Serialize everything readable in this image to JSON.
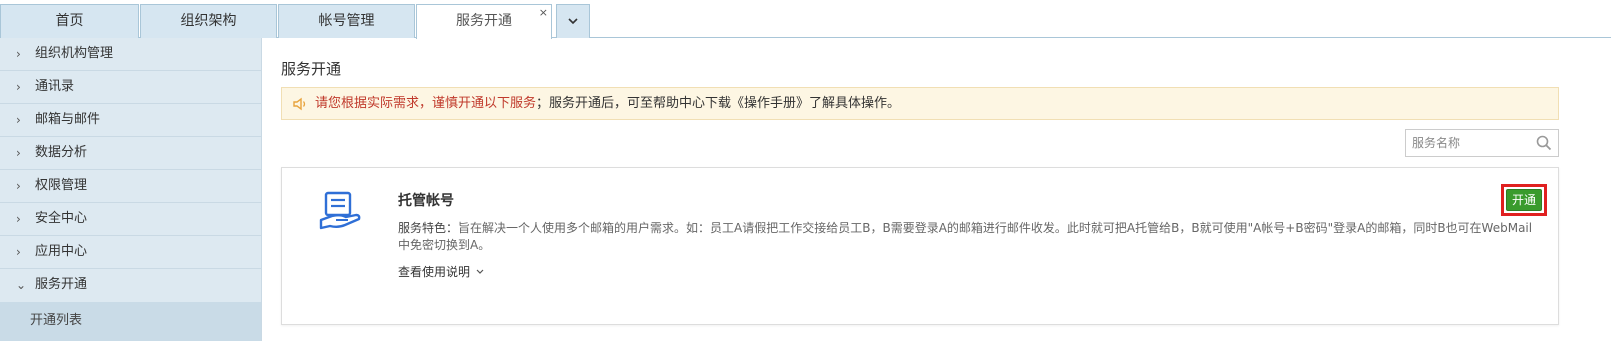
{
  "tabs": [
    {
      "label": "首页",
      "active": false
    },
    {
      "label": "组织架构",
      "active": false
    },
    {
      "label": "帐号管理",
      "active": false
    },
    {
      "label": "服务开通",
      "active": true,
      "close": "×"
    }
  ],
  "sidebar": {
    "items": [
      {
        "label": "组织机构管理",
        "chevron": "›"
      },
      {
        "label": "通讯录",
        "chevron": "›"
      },
      {
        "label": "邮箱与邮件",
        "chevron": "›"
      },
      {
        "label": "数据分析",
        "chevron": "›"
      },
      {
        "label": "权限管理",
        "chevron": "›"
      },
      {
        "label": "安全中心",
        "chevron": "›"
      },
      {
        "label": "应用中心",
        "chevron": "›"
      },
      {
        "label": "服务开通",
        "chevron": "⌄"
      }
    ],
    "sub_item": "开通列表"
  },
  "main": {
    "title": "服务开通",
    "notice": {
      "warning": "请您根据实际需求，谨慎开通以下服务",
      "rest": "；服务开通后，可至帮助中心下载《操作手册》了解具体操作。"
    },
    "search": {
      "placeholder": "服务名称"
    },
    "card": {
      "title": "托管帐号",
      "desc_key": "服务特色：",
      "desc": "旨在解决一个人使用多个邮箱的用户需求。如：员工A请假把工作交接给员工B，B需要登录A的邮箱进行邮件收发。此时就可把A托管给B，B就可使用\"A帐号+B密码\"登录A的邮箱，同时B也可在WebMail中免密切换到A。",
      "help": "查看使用说明",
      "open_label": "开通"
    }
  },
  "colors": {
    "tab_bg": "#d6e6f1",
    "sidebar_bg": "#dde9f1",
    "warning_text": "#c0392b",
    "open_button": "#3a9b2d",
    "highlight": "#e02020"
  }
}
